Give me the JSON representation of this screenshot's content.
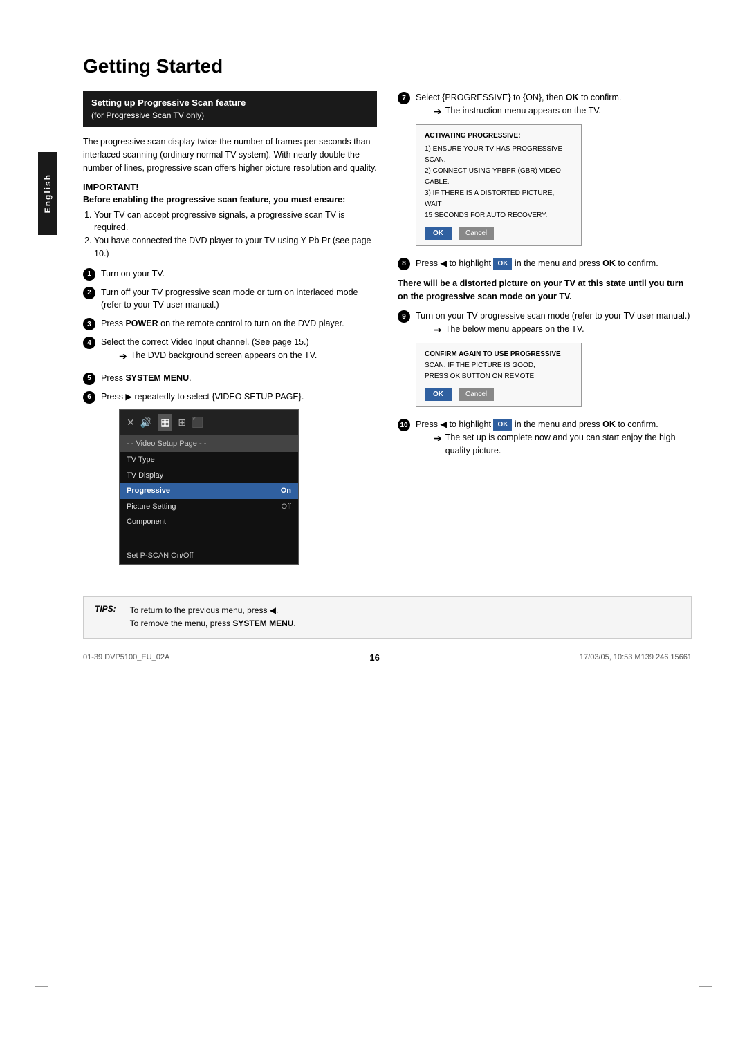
{
  "page": {
    "title": "Getting Started",
    "page_number": "16",
    "footer_left": "01-39 DVP5100_EU_02A",
    "footer_center": "16",
    "footer_right": "17/03/05, 10:53  M139 246 15661"
  },
  "english_tab": "English",
  "section": {
    "header_line1": "Setting up Progressive Scan feature",
    "header_line2": "(for Progressive Scan TV only)"
  },
  "left_col": {
    "intro": "The progressive scan display twice the number of frames per seconds than interlaced scanning (ordinary normal TV system). With nearly double the number of lines, progressive scan offers higher picture resolution and quality.",
    "important": "IMPORTANT!",
    "before_enabling": "Before enabling the progressive scan feature, you must ensure:",
    "list_items": [
      "Your TV can accept progressive signals, a progressive scan TV is required.",
      "You have connected the DVD player to your TV using Y Pb Pr (see page 10.)"
    ],
    "step1": "Turn on your TV.",
    "step2": "Turn off your TV progressive scan mode or turn on interlaced mode (refer to your TV user manual.)",
    "step3_prefix": "Press ",
    "step3_bold": "POWER",
    "step3_suffix": " on the remote control to turn on the DVD player.",
    "step4": "Select the correct Video Input channel. (See page 15.)",
    "step4_arrow": "The DVD background screen appears on the TV.",
    "step5_prefix": "Press ",
    "step5_bold": "SYSTEM MENU",
    "step5_suffix": ".",
    "step6_prefix": "Press ▶ repeatedly to select {VIDEO SETUP PAGE}.",
    "menu": {
      "header": "- - Video Setup Page - -",
      "rows": [
        {
          "label": "TV Type",
          "value": ""
        },
        {
          "label": "TV Display",
          "value": ""
        },
        {
          "label": "Progressive",
          "value": "On",
          "highlighted": true
        },
        {
          "label": "Picture Setting",
          "value": "Off"
        },
        {
          "label": "Component",
          "value": ""
        }
      ],
      "footer": "Set P-SCAN On/Off"
    }
  },
  "right_col": {
    "step7_prefix": "Select {PROGRESSIVE} to {ON}, then ",
    "step7_bold": "OK",
    "step7_suffix": " to confirm.",
    "step7_arrow": "The instruction menu appears on the TV.",
    "overlay1": {
      "title": "ACTIVATING PROGRESSIVE:",
      "lines": [
        "1) ENSURE YOUR TV HAS PROGRESSIVE SCAN.",
        "2) CONNECT USING YPBPR (GBR) VIDEO CABLE.",
        "3) IF THERE IS A DISTORTED PICTURE, WAIT",
        "    15 SECONDS FOR AUTO RECOVERY."
      ],
      "ok": "OK",
      "cancel": "Cancel"
    },
    "step8_prefix": "Press ◀ to highlight ",
    "step8_highlight": "OK",
    "step8_suffix": " in the menu and press ",
    "step8_bold": "OK",
    "step8_suffix2": " to confirm.",
    "bold_warning": "There will be a distorted picture on your TV at this state until you turn on the progressive scan mode on your TV.",
    "step9": "Turn on your TV progressive scan mode (refer to your TV user manual.)",
    "step9_arrow": "The below menu appears on the TV.",
    "overlay2": {
      "title": "CONFIRM AGAIN TO USE PROGRESSIVE",
      "lines": [
        "SCAN. IF THE PICTURE IS GOOD,",
        "PRESS OK BUTTON ON REMOTE"
      ],
      "ok": "OK",
      "cancel": "Cancel"
    },
    "step10_prefix": "Press ◀ to highlight ",
    "step10_highlight": "OK",
    "step10_suffix": " in the menu and press ",
    "step10_bold": "OK",
    "step10_suffix2": " to confirm.",
    "step10_arrow1": "The set up is complete now and you can start enjoy the high quality picture."
  },
  "tips": {
    "label": "TIPS:",
    "line1": "To return to the previous menu, press ◀.",
    "line2_prefix": "To remove the menu, press ",
    "line2_bold": "SYSTEM MENU",
    "line2_suffix": "."
  }
}
